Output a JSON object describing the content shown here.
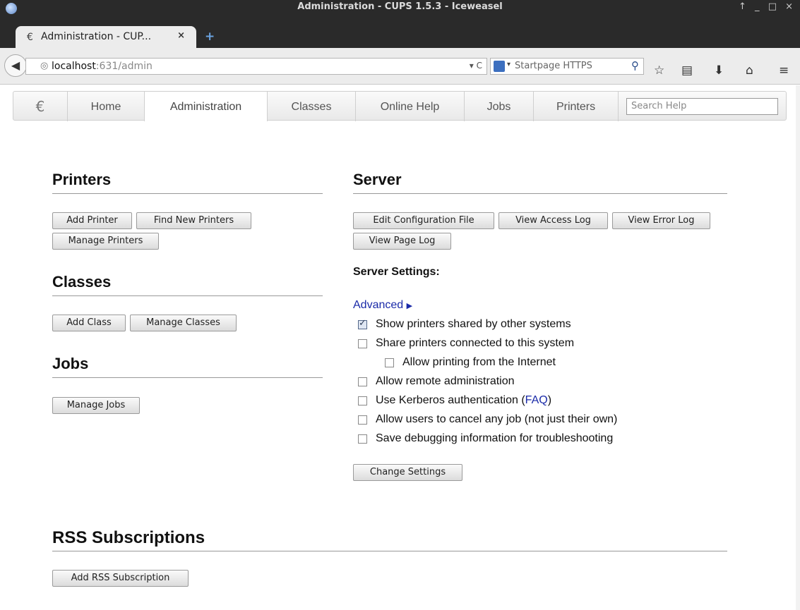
{
  "window": {
    "title": "Administration - CUPS 1.5.3 - Iceweasel",
    "controls": "↑ _ □ ×"
  },
  "tab": {
    "label": "Administration - CUP...",
    "close": "×",
    "new_tab": "+"
  },
  "navbar": {
    "url_host": "localhost",
    "url_path": ":631/admin",
    "url_tools": "▾ C",
    "search_engine_arrow": "▾",
    "search_placeholder": "Startpage HTTPS",
    "search_icon": "magnifier-icon",
    "icons": [
      "star-icon",
      "reading-list-icon",
      "download-icon",
      "home-icon",
      "menu-icon"
    ]
  },
  "cups_nav": {
    "items": [
      "Home",
      "Administration",
      "Classes",
      "Online Help",
      "Jobs",
      "Printers"
    ],
    "active": "Administration",
    "search_placeholder": "Search Help"
  },
  "printers": {
    "heading": "Printers",
    "buttons": [
      "Add Printer",
      "Find New Printers",
      "Manage Printers"
    ]
  },
  "classes": {
    "heading": "Classes",
    "buttons": [
      "Add Class",
      "Manage Classes"
    ]
  },
  "jobs": {
    "heading": "Jobs",
    "buttons": [
      "Manage Jobs"
    ]
  },
  "server": {
    "heading": "Server",
    "buttons": [
      "Edit Configuration File",
      "View Access Log",
      "View Error Log",
      "View Page Log"
    ],
    "settings_label": "Server Settings:",
    "advanced_label": "Advanced",
    "advanced_arrow": "▶",
    "options": [
      {
        "label": "Show printers shared by other systems",
        "checked": true
      },
      {
        "label": "Share printers connected to this system",
        "checked": false
      },
      {
        "label": "Allow printing from the Internet",
        "checked": false
      },
      {
        "label": "Allow remote administration",
        "checked": false
      },
      {
        "label": "Use Kerberos authentication (",
        "link": "FAQ",
        "suffix": ")",
        "checked": false
      },
      {
        "label": "Allow users to cancel any job (not just their own)",
        "checked": false
      },
      {
        "label": "Save debugging information for troubleshooting",
        "checked": false
      }
    ],
    "change_button": "Change Settings"
  },
  "rss": {
    "heading": "RSS Subscriptions",
    "buttons": [
      "Add RSS Subscription"
    ]
  }
}
